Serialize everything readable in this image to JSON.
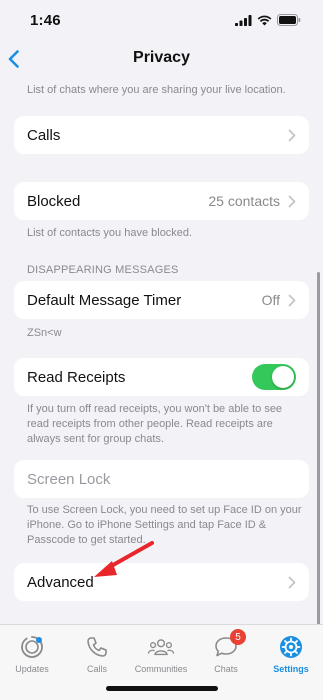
{
  "status_bar": {
    "time": "1:46"
  },
  "nav": {
    "title": "Privacy"
  },
  "live_location_footer": "List of chats where you are sharing your live location.",
  "calls": {
    "label": "Calls"
  },
  "blocked": {
    "label": "Blocked",
    "value": "25 contacts",
    "footer": "List of contacts you have blocked."
  },
  "disappearing": {
    "header": "DISAPPEARING MESSAGES",
    "timer_label": "Default Message Timer",
    "timer_value": "Off",
    "footer": "ZSn<w"
  },
  "read_receipts": {
    "label": "Read Receipts",
    "enabled": true,
    "footer": "If you turn off read receipts, you won't be able to see read receipts from other people. Read receipts are always sent for group chats."
  },
  "screen_lock": {
    "label": "Screen Lock",
    "footer": "To use Screen Lock, you need to set up Face ID on your iPhone. Go to iPhone Settings and tap Face ID & Passcode to get started."
  },
  "advanced": {
    "label": "Advanced"
  },
  "colors": {
    "accent": "#1a8fe3",
    "toggle_on": "#34c759",
    "badge": "#e94235",
    "annotation_arrow": "#e8262b"
  },
  "tabs": [
    {
      "label": "Updates",
      "icon": "updates-icon"
    },
    {
      "label": "Calls",
      "icon": "phone-icon"
    },
    {
      "label": "Communities",
      "icon": "communities-icon"
    },
    {
      "label": "Chats",
      "icon": "chats-icon",
      "badge": "5"
    },
    {
      "label": "Settings",
      "icon": "settings-gear-icon",
      "active": true
    }
  ]
}
